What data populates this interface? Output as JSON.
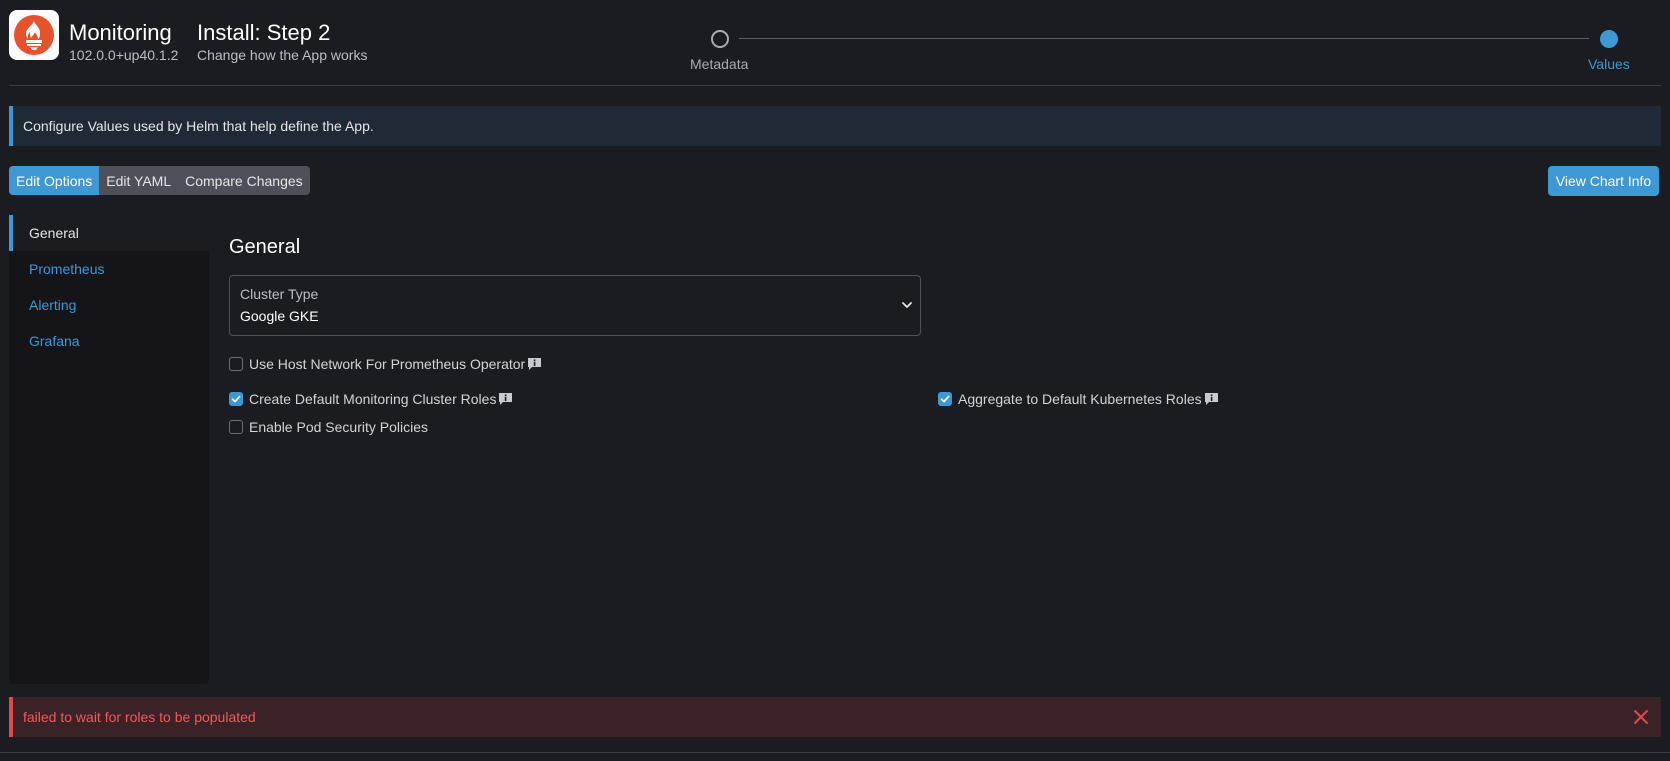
{
  "app": {
    "name": "Monitoring",
    "version": "102.0.0+up40.1.2",
    "logo_icon": "prometheus-flame-icon",
    "logo_color": "#e6522c"
  },
  "wizard": {
    "title": "Install: Step 2",
    "subtitle": "Change how the App works",
    "steps": [
      {
        "label": "Metadata",
        "state": "inactive"
      },
      {
        "label": "Values",
        "state": "active"
      }
    ]
  },
  "info_banner": {
    "text": "Configure Values used by Helm that help define the App."
  },
  "toolbar": {
    "tabs": [
      {
        "label": "Edit Options",
        "active": true
      },
      {
        "label": "Edit YAML",
        "active": false
      },
      {
        "label": "Compare Changes",
        "active": false
      }
    ],
    "view_chart_info_label": "View Chart Info"
  },
  "side_nav": {
    "items": [
      {
        "label": "General",
        "active": true
      },
      {
        "label": "Prometheus",
        "active": false
      },
      {
        "label": "Alerting",
        "active": false
      },
      {
        "label": "Grafana",
        "active": false
      }
    ]
  },
  "general": {
    "title": "General",
    "cluster_type": {
      "label": "Cluster Type",
      "value": "Google GKE"
    },
    "checkboxes": {
      "host_network": {
        "label": "Use Host Network For Prometheus Operator",
        "checked": false,
        "has_info": true
      },
      "create_roles": {
        "label": "Create Default Monitoring Cluster Roles",
        "checked": true,
        "has_info": true
      },
      "aggregate_roles": {
        "label": "Aggregate to Default Kubernetes Roles",
        "checked": true,
        "has_info": true
      },
      "pod_security": {
        "label": "Enable Pod Security Policies",
        "checked": false,
        "has_info": false
      }
    }
  },
  "error_banner": {
    "text": "failed to wait for roles to be populated"
  },
  "colors": {
    "accent": "#3d98d3",
    "background": "#1b1c21",
    "error": "#e24a4a"
  }
}
